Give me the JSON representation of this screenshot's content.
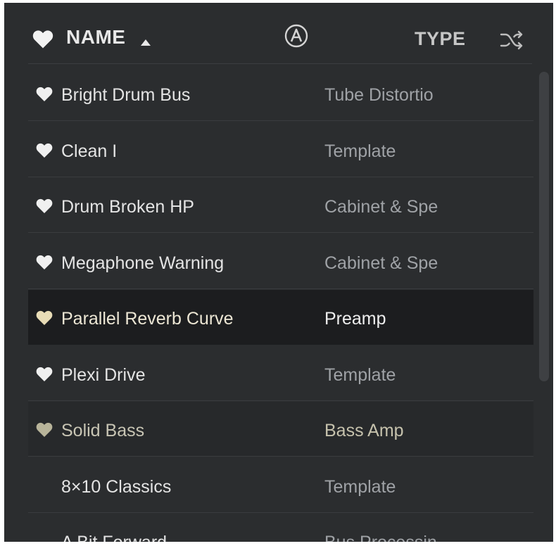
{
  "header": {
    "name_label": "NAME",
    "type_label": "TYPE",
    "sort_direction": "ascending",
    "icons": {
      "favorite": "heart-icon",
      "sort": "triangle-up-icon",
      "factory_filter": "arturia-logo-icon",
      "shuffle": "shuffle-icon"
    }
  },
  "colors": {
    "panel_bg": "#2b2d2f",
    "selected_row_bg": "#1c1d1f",
    "hover_row_bg": "#27292b",
    "heart_default": "#f0f0f0",
    "heart_selected": "#e8dcb6",
    "heart_hovered": "#b8b49a"
  },
  "presets": [
    {
      "name": "Bright Drum Bus",
      "type": "Tube Distortio",
      "favorite": true,
      "state": "normal"
    },
    {
      "name": "Clean I",
      "type": "Template",
      "favorite": true,
      "state": "normal"
    },
    {
      "name": "Drum Broken HP",
      "type": "Cabinet & Spe",
      "favorite": true,
      "state": "normal"
    },
    {
      "name": "Megaphone Warning",
      "type": "Cabinet & Spe",
      "favorite": true,
      "state": "normal"
    },
    {
      "name": "Parallel Reverb Curve",
      "type": "Preamp",
      "favorite": true,
      "state": "selected"
    },
    {
      "name": "Plexi Drive",
      "type": "Template",
      "favorite": true,
      "state": "normal"
    },
    {
      "name": "Solid Bass",
      "type": "Bass Amp",
      "favorite": true,
      "state": "hovered"
    },
    {
      "name": "8×10 Classics",
      "type": "Template",
      "favorite": false,
      "state": "normal"
    },
    {
      "name": "A Bit Forward",
      "type": "Bus Processin",
      "favorite": false,
      "state": "normal"
    }
  ]
}
